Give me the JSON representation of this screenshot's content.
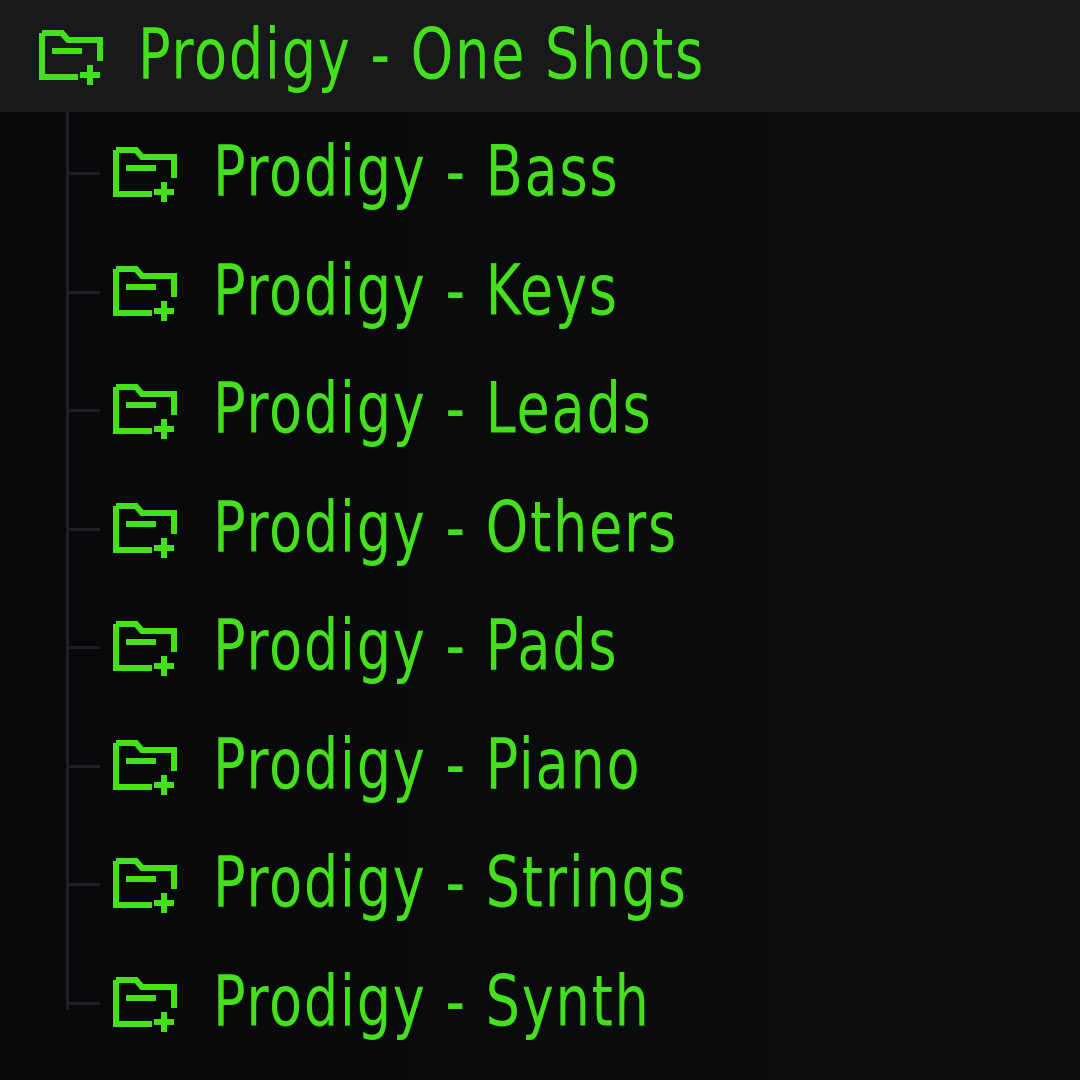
{
  "browser": {
    "parent": {
      "label": "Prodigy - One Shots",
      "icon": "folder-plus-icon"
    },
    "children": [
      {
        "label": "Prodigy - Bass",
        "icon": "folder-plus-icon"
      },
      {
        "label": "Prodigy - Keys",
        "icon": "folder-plus-icon"
      },
      {
        "label": "Prodigy - Leads",
        "icon": "folder-plus-icon"
      },
      {
        "label": "Prodigy - Others",
        "icon": "folder-plus-icon"
      },
      {
        "label": "Prodigy - Pads",
        "icon": "folder-plus-icon"
      },
      {
        "label": "Prodigy - Piano",
        "icon": "folder-plus-icon"
      },
      {
        "label": "Prodigy - Strings",
        "icon": "folder-plus-icon"
      },
      {
        "label": "Prodigy - Synth",
        "icon": "folder-plus-icon"
      }
    ]
  },
  "colors": {
    "text": "#44e01e",
    "background": "#0a0b0d",
    "selected_row": "#18191b",
    "tree_lines": "#1d1f22"
  }
}
